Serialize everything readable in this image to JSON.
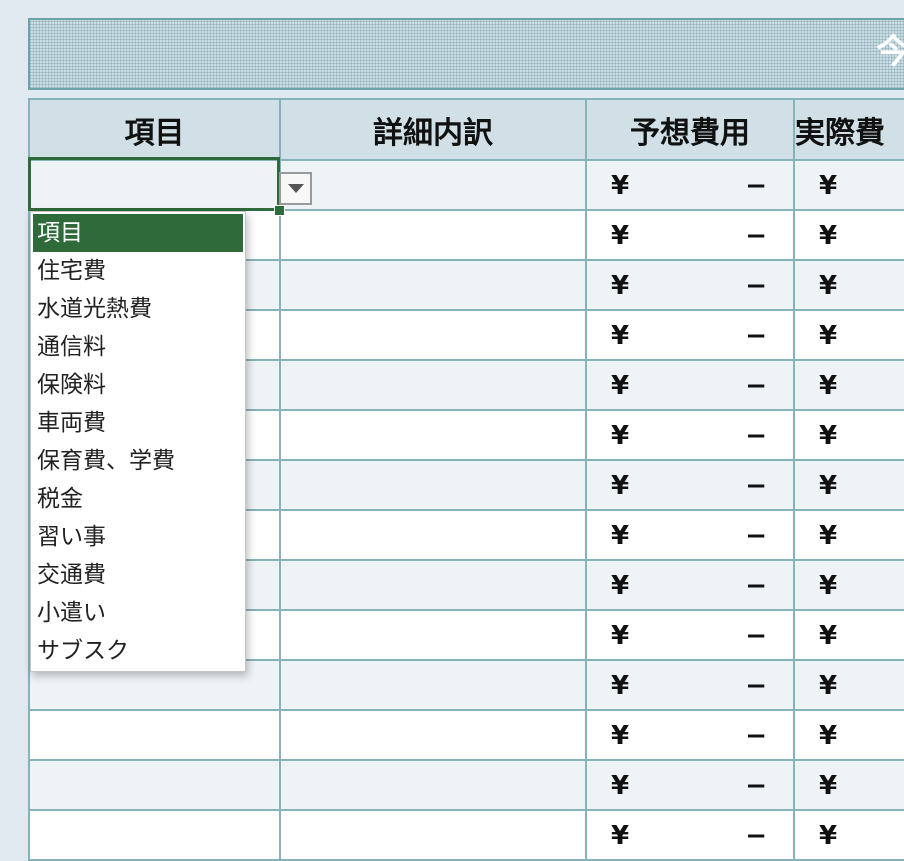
{
  "banner": {
    "title": "今"
  },
  "columns": [
    "項目",
    "詳細内訳",
    "予想費用",
    "実際費"
  ],
  "currency_symbol": "¥",
  "empty_amount": "−",
  "dropdown": {
    "items": [
      "項目",
      "住宅費",
      "水道光熱費",
      "通信料",
      "保険料",
      "車両費",
      "保育費、学費",
      "税金",
      "習い事",
      "交通費",
      "小遣い",
      "サブスク"
    ],
    "highlighted_index": 0
  },
  "colors": {
    "header_bg": "#d0e0e6",
    "border": "#86b2ba",
    "selection": "#2e6a3a",
    "page_bg": "#dfe9ef"
  }
}
